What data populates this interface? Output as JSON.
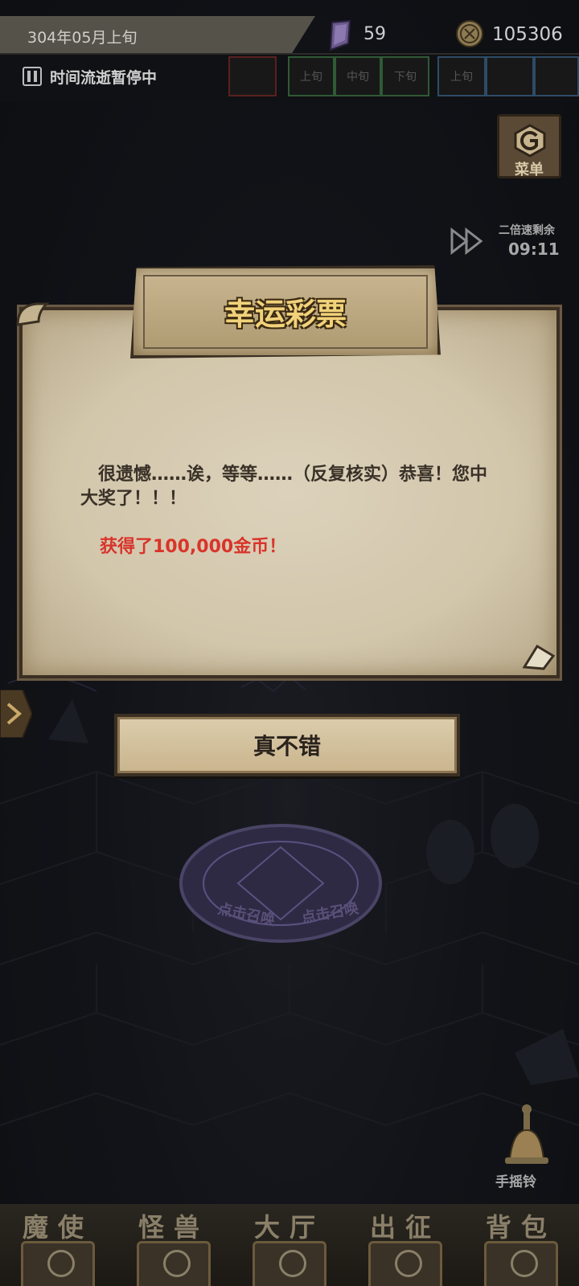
{
  "top_bar": {
    "date": "304年05月上旬",
    "crystal_count": "59",
    "gold_count": "105306"
  },
  "time_bar": {
    "status": "时间流逝暂停中",
    "segments": [
      "上旬",
      "中旬",
      "下旬",
      "上旬"
    ]
  },
  "side": {
    "menu_label": "菜单",
    "speed_label": "二倍速剩余",
    "speed_timer": "09:11",
    "bell_label": "手摇铃"
  },
  "dialog": {
    "title": "幸运彩票",
    "message": "很遗憾……诶，等等……（反复核实）恭喜！您中大奖了！！！",
    "reward": "获得了100,000金币！",
    "confirm_label": "真不错"
  },
  "summon": {
    "label": "点击召唤"
  },
  "bottom_nav": {
    "items": [
      {
        "label": "魔使"
      },
      {
        "label": "怪兽"
      },
      {
        "label": "大厅"
      },
      {
        "label": "出征"
      },
      {
        "label": "背包"
      }
    ]
  },
  "colors": {
    "title_gold": "#f1d27a",
    "reward_red": "#d9342b",
    "parchment": "#d2c6ab"
  }
}
